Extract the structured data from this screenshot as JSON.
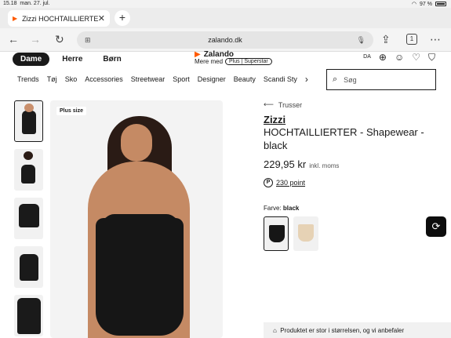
{
  "status": {
    "time": "15.18",
    "date": "man. 27. jul.",
    "battery": "97 %"
  },
  "tab": {
    "title": "Zizzi HOCHTAILLIERTER",
    "new_tab": "+"
  },
  "address": {
    "url": "zalando.dk",
    "tab_count": "1"
  },
  "site": {
    "segments": [
      "Dame",
      "Herre",
      "Børn"
    ],
    "logo": "Zalando",
    "mere_med": "Mere med",
    "plus_label": "Plus",
    "superstar_label": "Superstar",
    "lang": "DA",
    "categories": [
      "Trends",
      "Tøj",
      "Sko",
      "Accessories",
      "Streetwear",
      "Sport",
      "Designer",
      "Beauty",
      "Scandi Sty"
    ],
    "search_placeholder": "Søg"
  },
  "product": {
    "badge": "Plus size",
    "category": "Trusser",
    "brand": "Zizzi",
    "name": "HOCHTAILLIERTER - Shapewear - black",
    "price": "229,95 kr",
    "vat_note": "inkl. moms",
    "points": "230 point",
    "color_label": "Farve:",
    "color_value": "black",
    "fit_note": "Produktet er stor i størrelsen, og vi anbefaler"
  }
}
